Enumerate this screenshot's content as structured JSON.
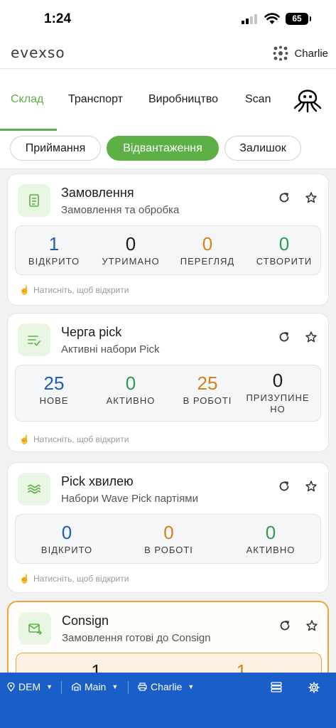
{
  "status_bar": {
    "time": "1:24",
    "battery": "65"
  },
  "app": {
    "logo": "evexso",
    "user_name": "Charlie"
  },
  "tabs": [
    {
      "label": "Склад",
      "active": true
    },
    {
      "label": "Транспорт",
      "active": false
    },
    {
      "label": "Виробництво",
      "active": false
    },
    {
      "label": "Scan",
      "active": false
    }
  ],
  "segments": [
    {
      "label": "Приймання",
      "active": false
    },
    {
      "label": "Відвантаження",
      "active": true
    },
    {
      "label": "Залишок",
      "active": false
    }
  ],
  "hint_text": "Натисніть, щоб відкрити",
  "cards": [
    {
      "title": "Замовлення",
      "subtitle": "Замовлення та обробка",
      "icon": "document-icon",
      "stats": [
        {
          "value": "1",
          "label": "ВІДКРИТО",
          "color": "#1f5db8"
        },
        {
          "value": "0",
          "label": "УТРИМАНО",
          "color": "#1c1c1e"
        },
        {
          "value": "0",
          "label": "ПЕРЕГЛЯД",
          "color": "#d4821e"
        },
        {
          "value": "0",
          "label": "СТВОРИТИ",
          "color": "#2e9b4f"
        }
      ]
    },
    {
      "title": "Черга pick",
      "subtitle": "Активні набори Pick",
      "icon": "list-check-icon",
      "stats": [
        {
          "value": "25",
          "label": "НОВЕ",
          "color": "#1f5db8"
        },
        {
          "value": "0",
          "label": "АКТИВНО",
          "color": "#2e9b4f"
        },
        {
          "value": "25",
          "label": "В РОБОТІ",
          "color": "#d4821e"
        },
        {
          "value": "0",
          "label": "ПРИЗУПИНЕНО",
          "color": "#1c1c1e"
        }
      ]
    },
    {
      "title": "Pick хвилею",
      "subtitle": "Набори Wave Pick партіями",
      "icon": "waves-icon",
      "stats": [
        {
          "value": "0",
          "label": "ВІДКРИТО",
          "color": "#1f5db8"
        },
        {
          "value": "0",
          "label": "В РОБОТІ",
          "color": "#d4821e"
        },
        {
          "value": "0",
          "label": "АКТИВНО",
          "color": "#2e9b4f"
        }
      ]
    },
    {
      "title": "Consign",
      "subtitle": "Замовлення готові до Consign",
      "icon": "mail-export-icon",
      "stats": [
        {
          "value": "1",
          "color": "#1c1c1e"
        },
        {
          "value": "1",
          "color": "#d4821e"
        }
      ]
    }
  ],
  "bottom_bar": {
    "location": "DEM",
    "warehouse": "Main",
    "printer_user": "Charlie"
  }
}
